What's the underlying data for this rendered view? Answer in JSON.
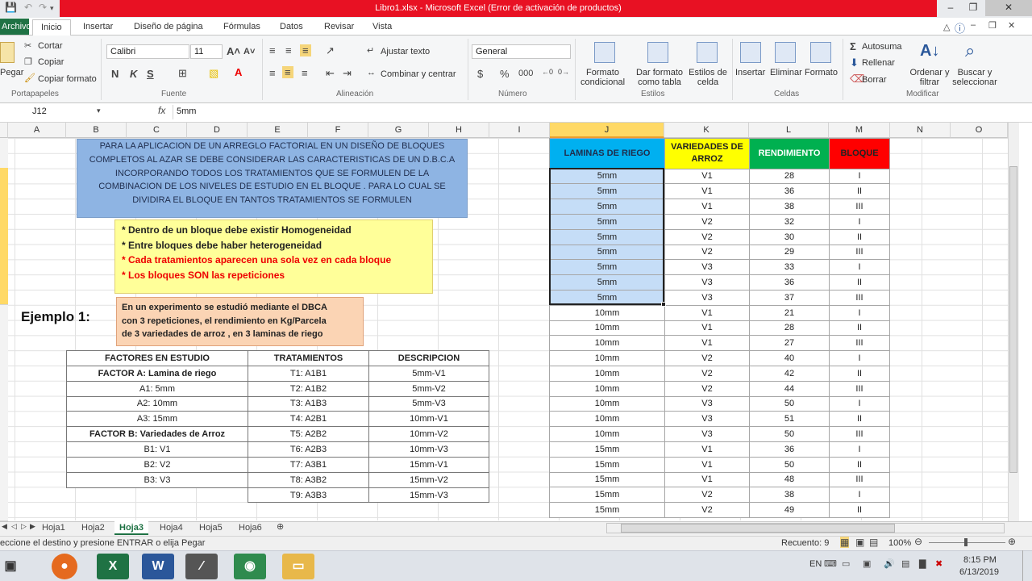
{
  "window": {
    "title": "Libro1.xlsx - Microsoft Excel (Error de activación de productos)"
  },
  "menu": {
    "file": "Archivo",
    "tabs": [
      "Inicio",
      "Insertar",
      "Diseño de página",
      "Fórmulas",
      "Datos",
      "Revisar",
      "Vista"
    ]
  },
  "ribbon": {
    "clipboard": {
      "paste": "Pegar",
      "cut": "Cortar",
      "copy": "Copiar",
      "format_painter": "Copiar formato",
      "label": "Portapapeles"
    },
    "font": {
      "name": "Calibri",
      "size": "11",
      "bold": "N",
      "italic": "K",
      "underline": "S",
      "label": "Fuente"
    },
    "alignment": {
      "wrap": "Ajustar texto",
      "merge": "Combinar y centrar",
      "label": "Alineación"
    },
    "number": {
      "format": "General",
      "currency": "$",
      "percent": "%",
      "thousands": "000",
      "label": "Número"
    },
    "styles": {
      "conditional": "Formato condicional",
      "as_table": "Dar formato como tabla",
      "cell_styles": "Estilos de celda",
      "label": "Estilos"
    },
    "cells": {
      "insert": "Insertar",
      "delete": "Eliminar",
      "format": "Formato",
      "label": "Celdas"
    },
    "editing": {
      "autosum": "Autosuma",
      "fill": "Rellenar",
      "clear": "Borrar",
      "sort": "Ordenar y filtrar",
      "find": "Buscar y seleccionar",
      "label": "Modificar"
    }
  },
  "formula_bar": {
    "name_box": "J12",
    "fx": "fx",
    "value": "5mm"
  },
  "columns": [
    "A",
    "B",
    "C",
    "D",
    "E",
    "F",
    "G",
    "H",
    "I",
    "J",
    "K",
    "L",
    "M",
    "N",
    "O"
  ],
  "intro_text": [
    "PARA LA APLICACION DE UN ARREGLO FACTORIAL EN UN DISEÑO DE BLOQUES",
    "COMPLETOS AL AZAR SE DEBE CONSIDERAR LAS CARACTERISTICAS DE UN D.B.C.A",
    "INCORPORANDO TODOS LOS TRATAMIENTOS QUE SE FORMULEN DE LA",
    "COMBINACION DE LOS NIVELES DE ESTUDIO EN EL BLOQUE . PARA LO CUAL SE",
    "DIVIDIRA EL BLOQUE EN TANTOS TRATAMIENTOS SE FORMULEN"
  ],
  "notes": [
    "* Dentro de un bloque debe existir Homogeneidad",
    "* Entre bloques debe haber heterogeneidad",
    "* Cada tratamientos aparecen una sola vez en cada bloque",
    "* Los bloques SON las repeticiones"
  ],
  "example": {
    "heading": "Ejemplo 1:",
    "text": [
      "En un experimento se estudió mediante el DBCA",
      "con 3 repeticiones, el rendimiento en Kg/Parcela",
      "de 3 variedades de arroz , en 3 laminas de riego"
    ]
  },
  "factors_table": {
    "headers": [
      "FACTORES EN ESTUDIO",
      "TRATAMIENTOS",
      "DESCRIPCION"
    ],
    "rows": [
      [
        "FACTOR A: Lamina de riego",
        "T1: A1B1",
        "5mm-V1"
      ],
      [
        "A1: 5mm",
        "T2: A1B2",
        "5mm-V2"
      ],
      [
        "A2: 10mm",
        "T3: A1B3",
        "5mm-V3"
      ],
      [
        "A3: 15mm",
        "T4: A2B1",
        "10mm-V1"
      ],
      [
        "FACTOR B: Variedades de Arroz",
        "T5: A2B2",
        "10mm-V2"
      ],
      [
        "B1: V1",
        "T6: A2B3",
        "10mm-V3"
      ],
      [
        "B2: V2",
        "T7: A3B1",
        "15mm-V1"
      ],
      [
        "B3: V3",
        "T8: A3B2",
        "15mm-V2"
      ],
      [
        "",
        "T9: A3B3",
        "15mm-V3"
      ]
    ]
  },
  "data_table": {
    "headers": [
      "LAMINAS DE RIEGO",
      "VARIEDADES DE ARROZ",
      "RENDIMIENTO",
      "BLOQUE"
    ],
    "header_colors": [
      "#00b0f0",
      "#ffff00",
      "#00b050",
      "#ff0000"
    ],
    "rows": [
      [
        "5mm",
        "V1",
        "28",
        "I"
      ],
      [
        "5mm",
        "V1",
        "36",
        "II"
      ],
      [
        "5mm",
        "V1",
        "38",
        "III"
      ],
      [
        "5mm",
        "V2",
        "32",
        "I"
      ],
      [
        "5mm",
        "V2",
        "30",
        "II"
      ],
      [
        "5mm",
        "V2",
        "29",
        "III"
      ],
      [
        "5mm",
        "V3",
        "33",
        "I"
      ],
      [
        "5mm",
        "V3",
        "36",
        "II"
      ],
      [
        "5mm",
        "V3",
        "37",
        "III"
      ],
      [
        "10mm",
        "V1",
        "21",
        "I"
      ],
      [
        "10mm",
        "V1",
        "28",
        "II"
      ],
      [
        "10mm",
        "V1",
        "27",
        "III"
      ],
      [
        "10mm",
        "V2",
        "40",
        "I"
      ],
      [
        "10mm",
        "V2",
        "42",
        "II"
      ],
      [
        "10mm",
        "V2",
        "44",
        "III"
      ],
      [
        "10mm",
        "V3",
        "50",
        "I"
      ],
      [
        "10mm",
        "V3",
        "51",
        "II"
      ],
      [
        "10mm",
        "V3",
        "50",
        "III"
      ],
      [
        "15mm",
        "V1",
        "36",
        "I"
      ],
      [
        "15mm",
        "V1",
        "50",
        "II"
      ],
      [
        "15mm",
        "V1",
        "48",
        "III"
      ],
      [
        "15mm",
        "V2",
        "38",
        "I"
      ],
      [
        "15mm",
        "V2",
        "49",
        "II"
      ]
    ]
  },
  "sheets": [
    "Hoja1",
    "Hoja2",
    "Hoja3",
    "Hoja4",
    "Hoja5",
    "Hoja6"
  ],
  "active_sheet": "Hoja3",
  "status": {
    "message": "eccione el destino y presione ENTRAR o elija Pegar",
    "count": "Recuento: 9",
    "zoom": "100%"
  },
  "taskbar": {
    "lang": "EN",
    "time": "8:15 PM",
    "date": "6/13/2019"
  }
}
